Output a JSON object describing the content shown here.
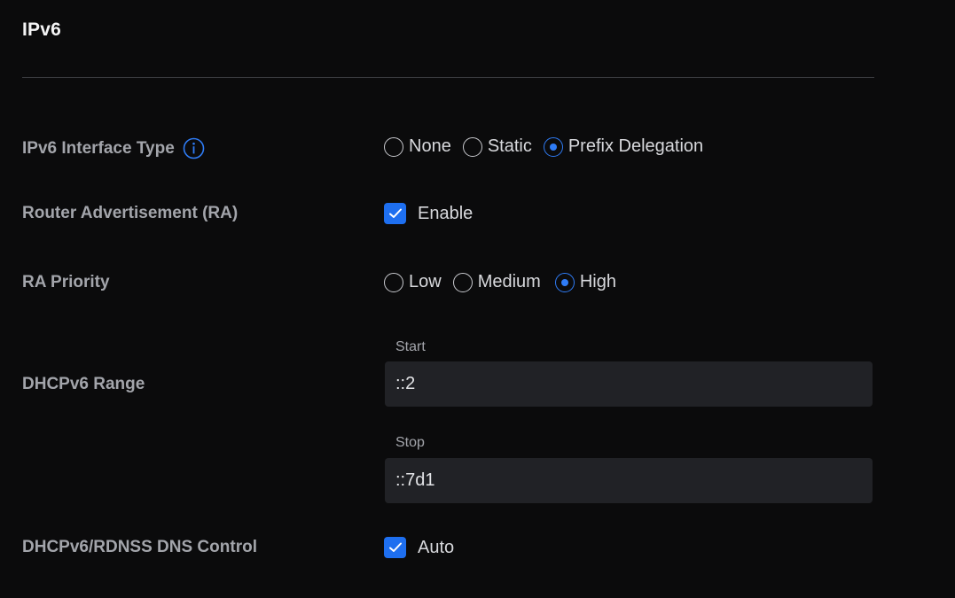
{
  "section": {
    "title": "IPv6"
  },
  "colors": {
    "background": "#0b0b0c",
    "accent": "#2f7cf6",
    "checkbox": "#1e6ff0",
    "input_bg": "#212226",
    "label": "#a3a5ab"
  },
  "interface_type": {
    "label": "IPv6 Interface Type",
    "info_icon": "info-icon",
    "options": [
      {
        "label": "None",
        "checked": false
      },
      {
        "label": "Static",
        "checked": false
      },
      {
        "label": "Prefix Delegation",
        "checked": true
      }
    ]
  },
  "router_advertisement": {
    "label": "Router Advertisement (RA)",
    "checkbox_label": "Enable",
    "checked": true
  },
  "ra_priority": {
    "label": "RA Priority",
    "options": [
      {
        "label": "Low",
        "checked": false
      },
      {
        "label": "Medium",
        "checked": false
      },
      {
        "label": "High",
        "checked": true
      }
    ]
  },
  "dhcpv6_range": {
    "label": "DHCPv6 Range",
    "start_caption": "Start",
    "start_value": "::2",
    "stop_caption": "Stop",
    "stop_value": "::7d1"
  },
  "dns_control": {
    "label": "DHCPv6/RDNSS DNS Control",
    "checkbox_label": "Auto",
    "checked": true
  }
}
